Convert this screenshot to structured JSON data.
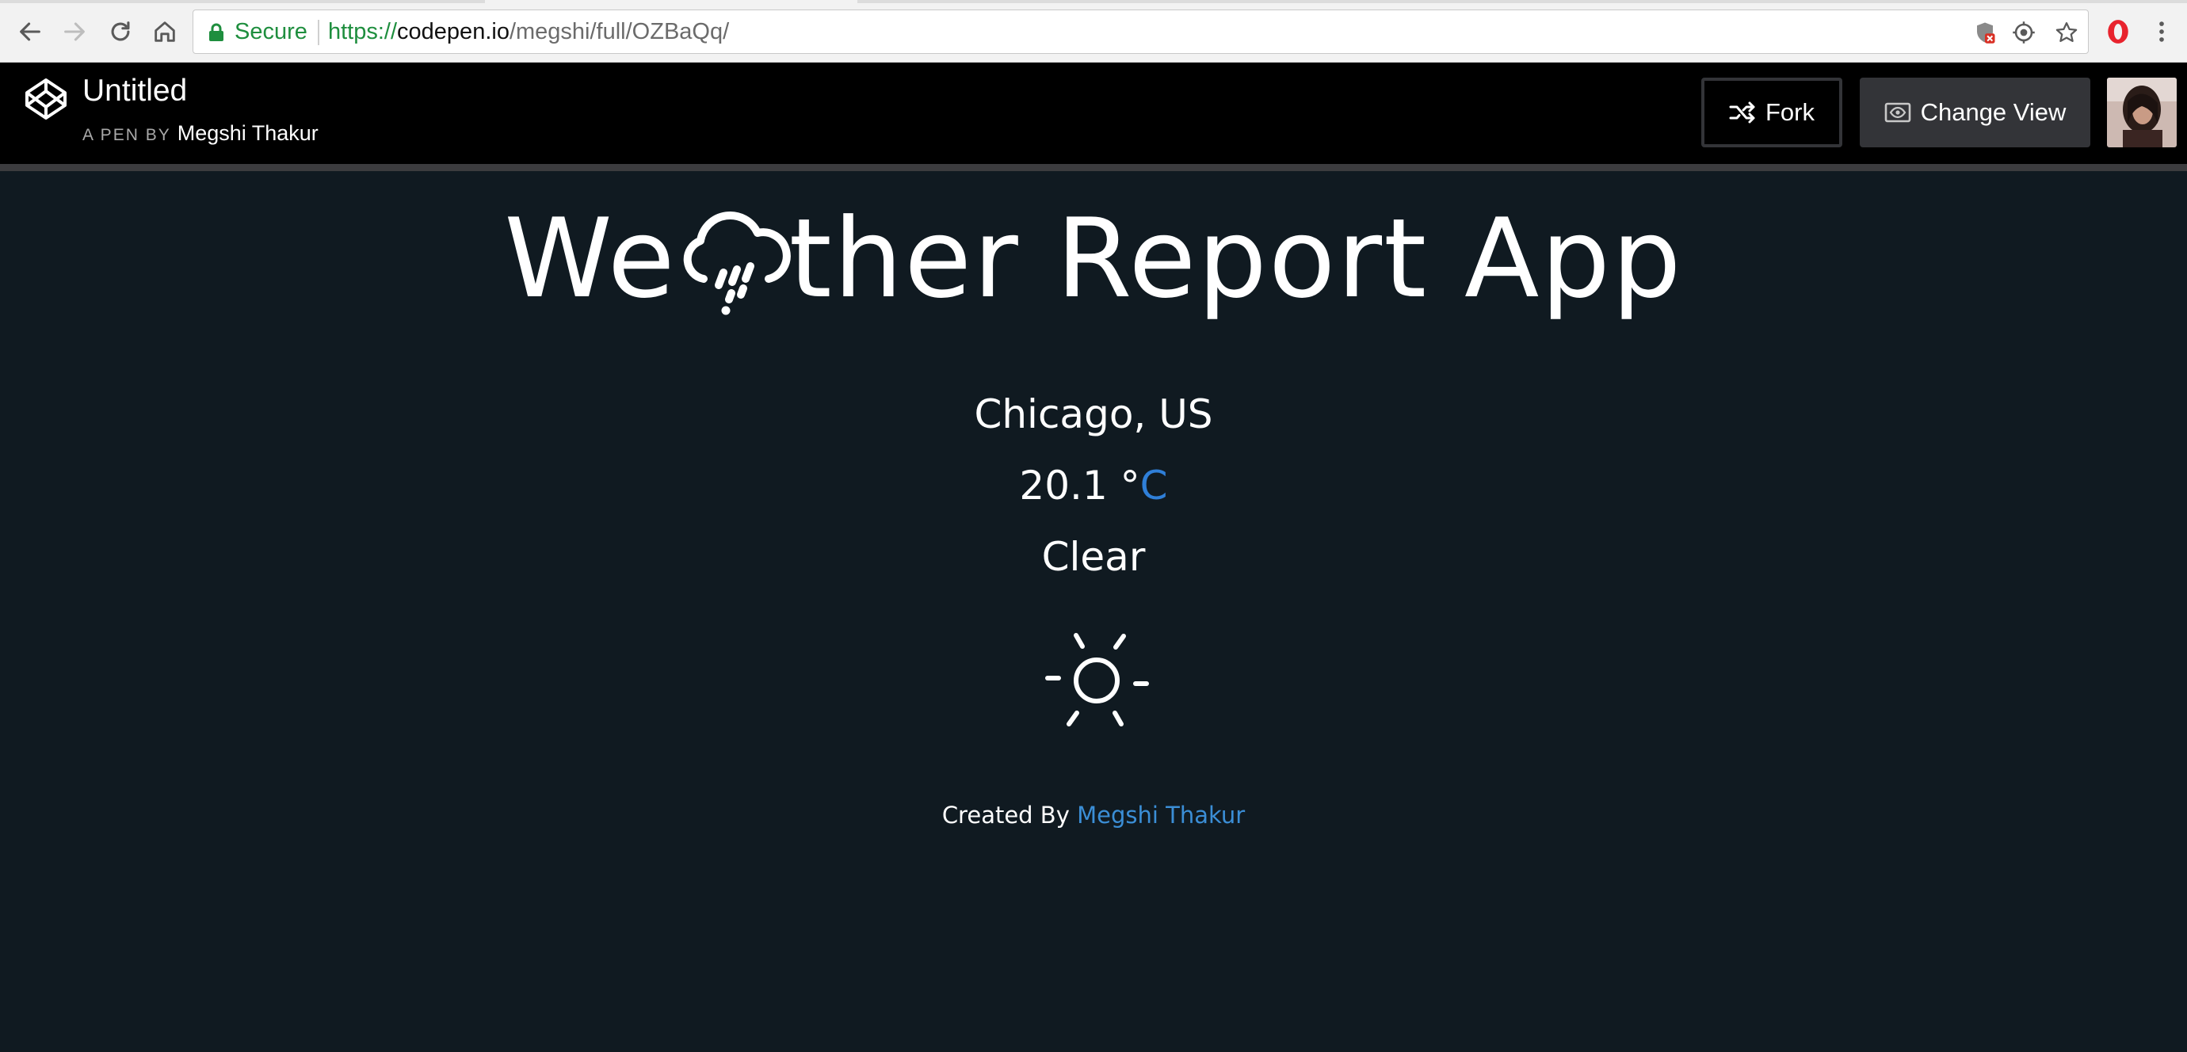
{
  "browser": {
    "secure_label": "Secure",
    "url_scheme": "https://",
    "url_host": "codepen.io",
    "url_path": "/megshi/full/OZBaQq/",
    "icons": [
      "back-icon",
      "forward-icon",
      "reload-icon",
      "home-icon",
      "lock-icon",
      "shield-blocked-icon",
      "target-icon",
      "star-icon",
      "opera-icon",
      "kebab-menu-icon"
    ]
  },
  "codepen": {
    "pen_title": "Untitled",
    "by_label": "A PEN BY",
    "author": "Megshi Thakur",
    "fork_label": "Fork",
    "change_view_label": "Change View"
  },
  "app": {
    "title_before": "We",
    "title_after": "ther Report App",
    "title_icon": "cloud-rain-icon",
    "city": "Chicago, US",
    "temperature": "20.1",
    "degree_symbol": "°",
    "unit": "C",
    "condition": "Clear",
    "condition_icon": "sun-icon",
    "credit_label": "Created By",
    "credit_author": "Megshi Thakur"
  },
  "colors": {
    "background": "#101a21",
    "header": "#000000",
    "accent_blue": "#2f7fd8",
    "secure_green": "#1e8e3e"
  }
}
